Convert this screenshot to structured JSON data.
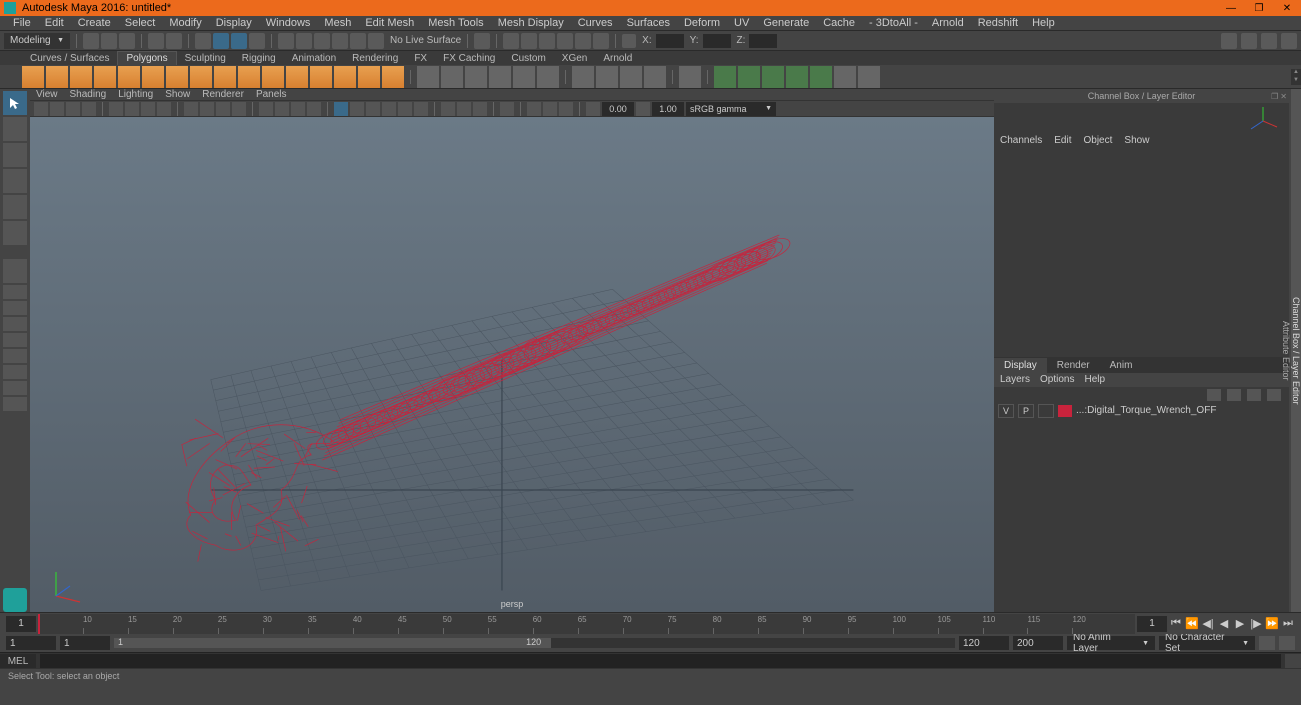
{
  "window": {
    "title": "Autodesk Maya 2016: untitled*"
  },
  "menus": [
    "File",
    "Edit",
    "Create",
    "Select",
    "Modify",
    "Display",
    "Windows",
    "Mesh",
    "Edit Mesh",
    "Mesh Tools",
    "Mesh Display",
    "Curves",
    "Surfaces",
    "Deform",
    "UV",
    "Generate",
    "Cache",
    "- 3DtoAll -",
    "Arnold",
    "Redshift",
    "Help"
  ],
  "workspace": "Modeling",
  "statusLine": {
    "noLiveSurface": "No Live Surface",
    "axes": {
      "x": "X:",
      "y": "Y:",
      "z": "Z:"
    }
  },
  "shelf": {
    "tabs": [
      "Curves / Surfaces",
      "Polygons",
      "Sculpting",
      "Rigging",
      "Animation",
      "Rendering",
      "FX",
      "FX Caching",
      "Custom",
      "XGen",
      "Arnold"
    ],
    "active": "Polygons"
  },
  "panel": {
    "menus": [
      "View",
      "Shading",
      "Lighting",
      "Show",
      "Renderer",
      "Panels"
    ],
    "exposure": "0.00",
    "gamma": "1.00",
    "colorspace": "sRGB gamma",
    "camera": "persp"
  },
  "channelBox": {
    "title": "Channel Box / Layer Editor",
    "menus": [
      "Channels",
      "Edit",
      "Object",
      "Show"
    ],
    "tabs": [
      "Display",
      "Render",
      "Anim"
    ],
    "tabActive": "Display",
    "layerMenu": [
      "Layers",
      "Options",
      "Help"
    ],
    "layer": {
      "v": "V",
      "p": "P",
      "name": "...:Digital_Torque_Wrench_OFF"
    }
  },
  "sideTabs": [
    "Channel Box / Layer Editor",
    "Attribute Editor"
  ],
  "timeline": {
    "start1": "1",
    "start2": "1",
    "curFrame": "1",
    "rangeStart": "1",
    "rangeEnd": "120",
    "end1": "120",
    "end2": "200",
    "animLayer": "No Anim Layer",
    "charSet": "No Character Set",
    "ticks": [
      "10",
      "15",
      "20",
      "25",
      "30",
      "35",
      "40",
      "45",
      "50",
      "55",
      "60",
      "65",
      "70",
      "75",
      "80",
      "85",
      "90",
      "95",
      "100",
      "105",
      "110",
      "115",
      "120"
    ]
  },
  "cmd": {
    "lang": "MEL"
  },
  "helpLine": "Select Tool: select an object"
}
